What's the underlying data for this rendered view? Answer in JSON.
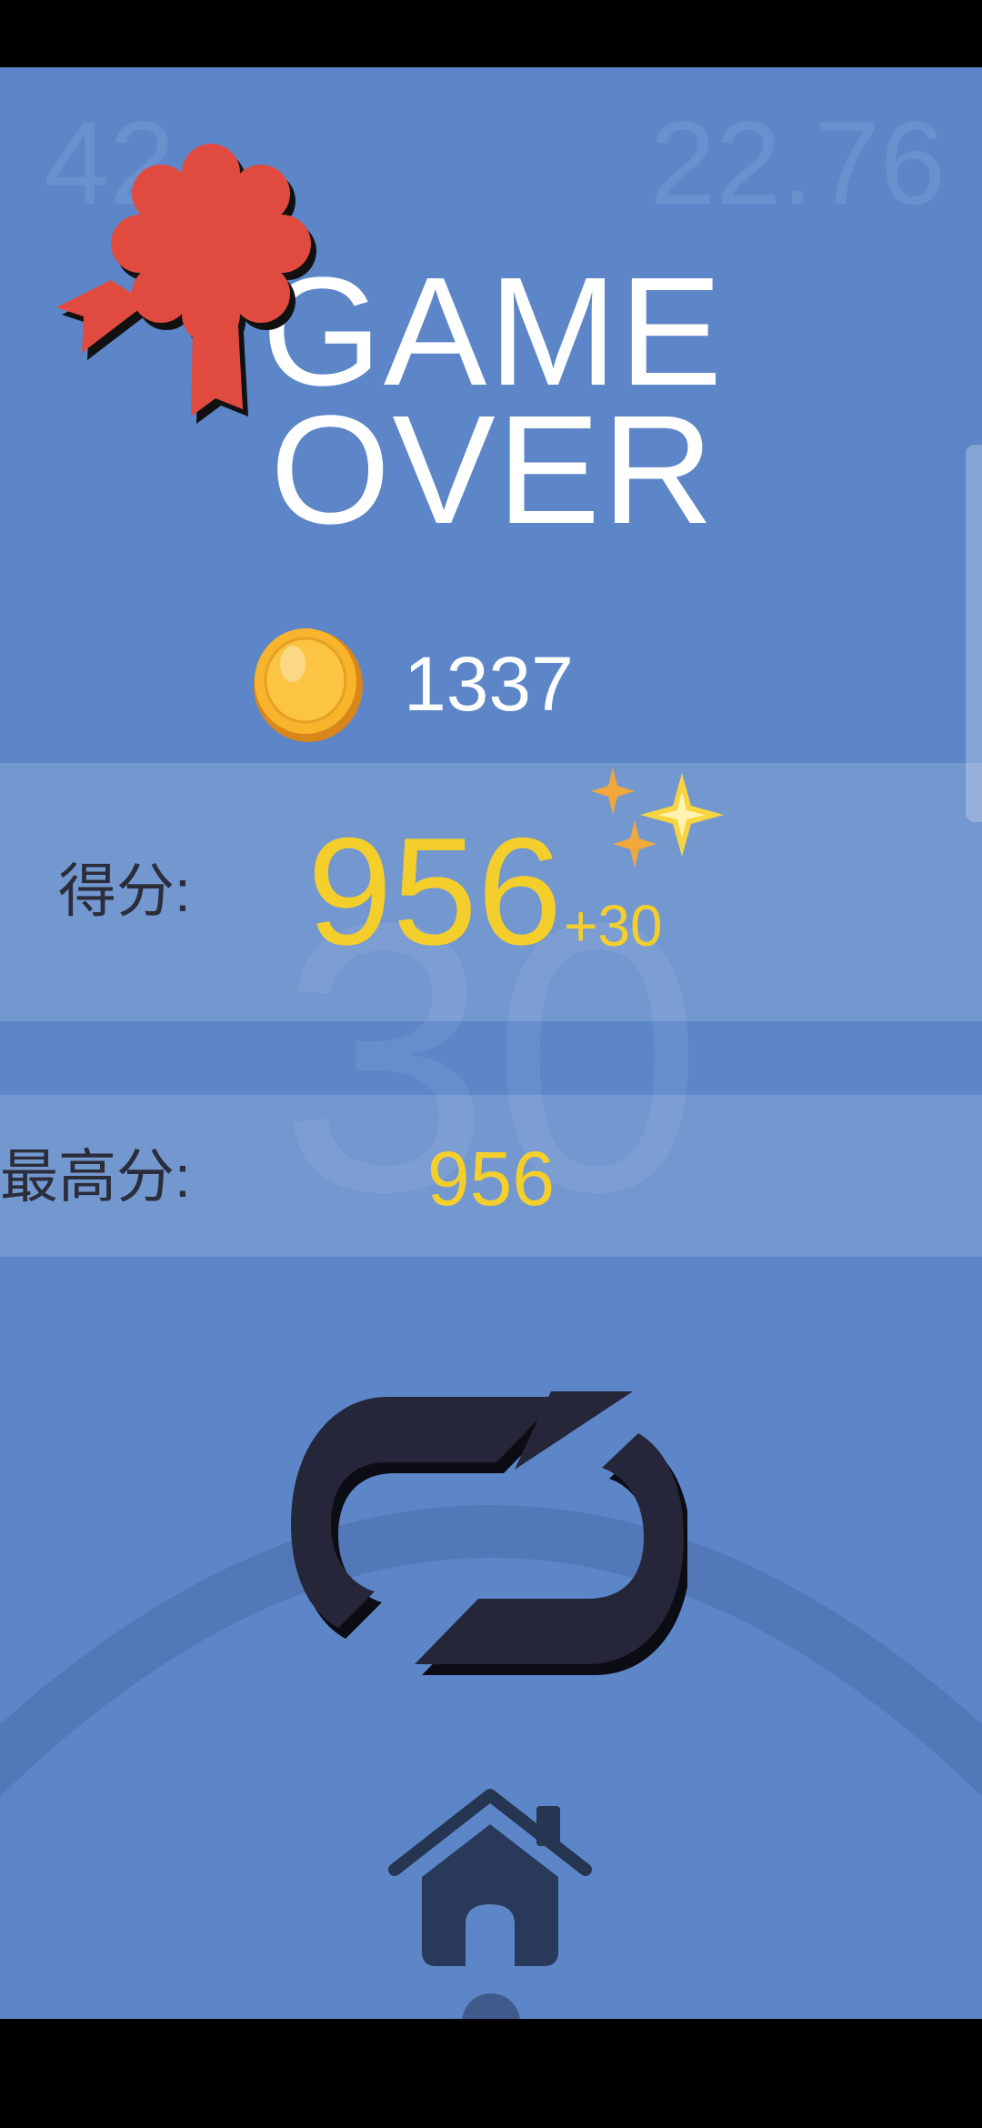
{
  "hud": {
    "left_value": "42",
    "right_value": "22.76"
  },
  "title": {
    "line1": "GAME",
    "line2": "OVER"
  },
  "coins": {
    "count": "1337",
    "icon": "coin-icon"
  },
  "score": {
    "label": "得分:",
    "value": "956",
    "bonus": "+30",
    "background_number": "30"
  },
  "best": {
    "label": "最高分:",
    "value": "956"
  },
  "buttons": {
    "restart_icon": "restart-icon",
    "home_icon": "home-icon"
  },
  "colors": {
    "background": "#5c86c8",
    "score_yellow": "#f4cf2c",
    "ribbon_red": "#e04a3f",
    "icon_dark": "#26263a"
  }
}
